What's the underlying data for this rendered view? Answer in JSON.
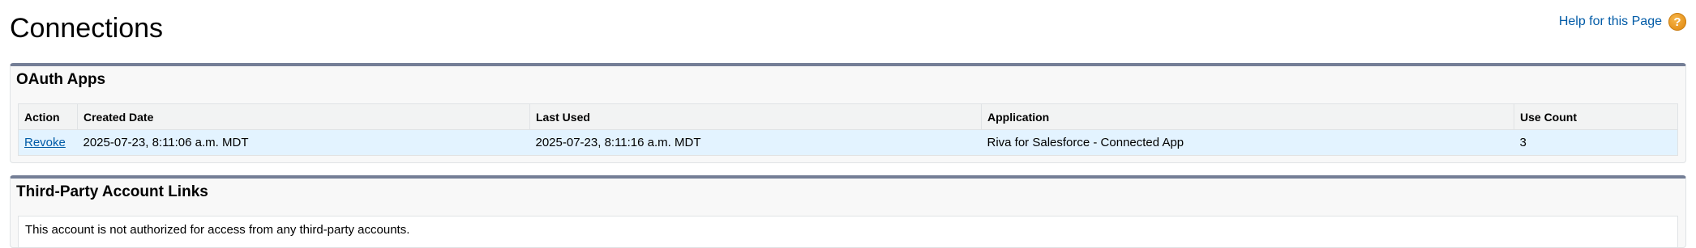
{
  "header": {
    "title": "Connections",
    "help_link": "Help for this Page",
    "help_icon": "help-question-icon",
    "help_icon_glyph": "?"
  },
  "oauth_apps": {
    "title": "OAuth Apps",
    "columns": [
      "Action",
      "Created Date",
      "Last Used",
      "Application",
      "Use Count"
    ],
    "rows": [
      {
        "action": "Revoke",
        "created_date": "2025-07-23, 8:11:06 a.m. MDT",
        "last_used": "2025-07-23, 8:11:16 a.m. MDT",
        "application": "Riva for Salesforce - Connected App",
        "use_count": "3"
      }
    ]
  },
  "third_party": {
    "title": "Third-Party Account Links",
    "message": "This account is not authorized for access from any third-party accounts."
  },
  "colors": {
    "accent_link": "#015ba7",
    "panel_border": "#747e96",
    "row_highlight": "#e3f3ff",
    "help_icon": "#e5911a"
  }
}
